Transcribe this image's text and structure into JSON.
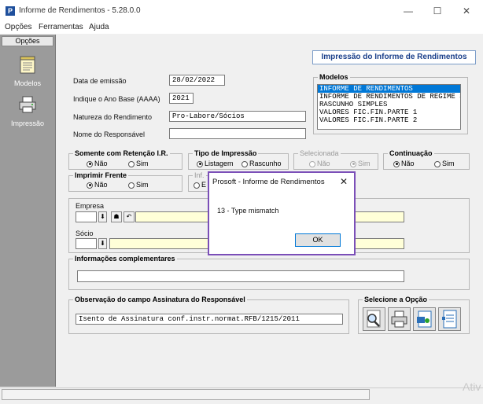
{
  "window": {
    "title": "Informe de Rendimentos - 5.28.0.0",
    "minimize": "—",
    "maximize": "☐",
    "close": "✕"
  },
  "menu": [
    "Opções",
    "Ferramentas",
    "Ajuda"
  ],
  "left_panel": {
    "header": "Opções",
    "items": [
      {
        "label": "Modelos",
        "icon": "notepad-icon"
      },
      {
        "label": "Impressão",
        "icon": "printer-icon"
      }
    ]
  },
  "header_button": "Impressão do Informe de Rendimentos",
  "form": {
    "data_emissao_label": "Data de emissão",
    "data_emissao_value": "28/02/2022",
    "ano_base_label": "Indique o Ano Base (AAAA)",
    "ano_base_value": "2021",
    "natureza_label": "Natureza do Rendimento",
    "natureza_value": "Pro-Labore/Sócios",
    "responsavel_label": "Nome do Responsável",
    "responsavel_value": ""
  },
  "modelos": {
    "title": "Modelos",
    "items": [
      "INFORME DE RENDIMENTOS",
      "INFORME DE RENDIMENTOS DE REGIME S",
      "RASCUNHO SIMPLES",
      "VALORES FIC.FIN.PARTE 1",
      "VALORES FIC.FIN.PARTE 2"
    ],
    "selected_index": 0
  },
  "groups": {
    "retencao": {
      "title": "Somente com Retenção I.R.",
      "options": [
        "Não",
        "Sim"
      ],
      "selected": "Não"
    },
    "tipo_impressao": {
      "title": "Tipo de Impressão",
      "options": [
        "Listagem",
        "Rascunho"
      ],
      "selected": "Listagem"
    },
    "selecionada": {
      "title": "Selecionada",
      "options": [
        "Não",
        "Sim"
      ],
      "selected": "Sim",
      "disabled": true
    },
    "continuacao": {
      "title": "Continuação",
      "options": [
        "Não",
        "Sim"
      ],
      "selected": "Não"
    },
    "imprimir_frente": {
      "title": "Imprimir Frente",
      "options": [
        "Não",
        "Sim"
      ],
      "selected": "Não"
    },
    "inf": {
      "title": "Inf.",
      "option_partial": "E"
    }
  },
  "empresa": {
    "label": "Empresa",
    "value": ""
  },
  "socio": {
    "label": "Sócio",
    "value": ""
  },
  "info_compl": {
    "title": "Informações complementares",
    "value": ""
  },
  "observacao": {
    "title": "Observação do campo Assinatura do Responsável",
    "value": "Isento de Assinatura conf.instr.normat.RFB/1215/2011"
  },
  "selecione": {
    "title": "Selecione a Opção",
    "buttons": [
      "preview-icon",
      "print-icon",
      "export-icon",
      "document-icon"
    ]
  },
  "dialog": {
    "title": "Prosoft - Informe de Rendimentos",
    "close": "✕",
    "message": "13 - Type mismatch",
    "ok": "OK"
  },
  "watermark": "Ativ",
  "colors": {
    "selection": "#0078d7",
    "dialog_border": "#7b4fb8",
    "header_text": "#1a3f8a"
  }
}
